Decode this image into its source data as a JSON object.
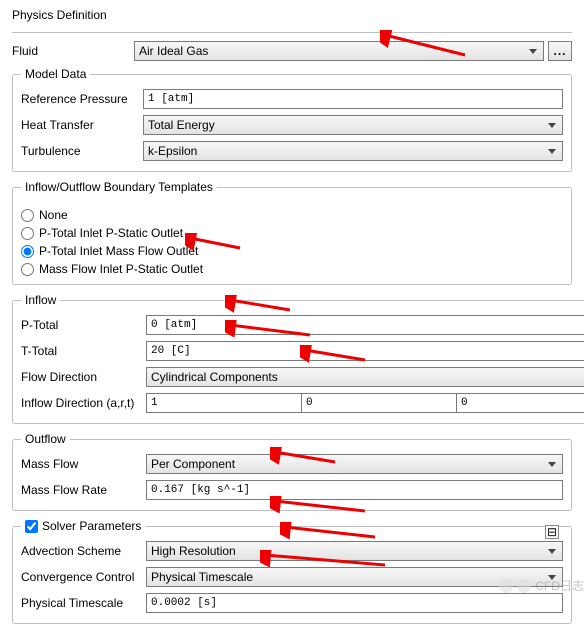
{
  "title": "Physics Definition",
  "fluid": {
    "label": "Fluid",
    "value": "Air Ideal Gas",
    "dots": "..."
  },
  "modelData": {
    "legend": "Model Data",
    "refPressure": {
      "label": "Reference Pressure",
      "value": "1 [atm]"
    },
    "heatTransfer": {
      "label": "Heat Transfer",
      "value": "Total Energy"
    },
    "turbulence": {
      "label": "Turbulence",
      "value": "k-Epsilon"
    }
  },
  "boundary": {
    "legend": "Inflow/Outflow Boundary Templates",
    "options": {
      "none": "None",
      "opt1": "P-Total Inlet  P-Static Outlet",
      "opt2": "P-Total Inlet  Mass Flow Outlet",
      "opt3": "Mass Flow Inlet  P-Static Outlet"
    }
  },
  "inflow": {
    "legend": "Inflow",
    "pTotal": {
      "label": "P-Total",
      "value": "0 [atm]"
    },
    "tTotal": {
      "label": "T-Total",
      "value": "20 [C]"
    },
    "flowDir": {
      "label": "Flow Direction",
      "value": "Cylindrical Components"
    },
    "inflowDir": {
      "label": "Inflow Direction (a,r,t)",
      "a": "1",
      "r": "0",
      "t": "0"
    }
  },
  "outflow": {
    "legend": "Outflow",
    "massFlow": {
      "label": "Mass Flow",
      "value": "Per Component"
    },
    "massFlowRate": {
      "label": "Mass Flow Rate",
      "value": "0.167 [kg s^-1]"
    }
  },
  "solver": {
    "legend": "Solver Parameters",
    "advection": {
      "label": "Advection Scheme",
      "value": "High Resolution"
    },
    "convergence": {
      "label": "Convergence Control",
      "value": "Physical Timescale"
    },
    "timescale": {
      "label": "Physical Timescale",
      "value": "0.0002 [s]"
    }
  },
  "watermark": "CFD日志"
}
